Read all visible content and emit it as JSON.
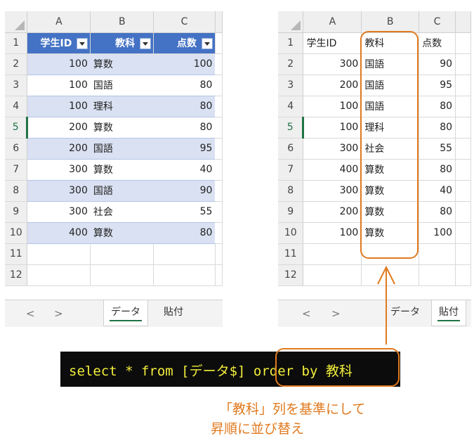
{
  "left_sheet": {
    "col_headers": [
      "A",
      "B",
      "C"
    ],
    "row_numbers": [
      "1",
      "2",
      "3",
      "4",
      "5",
      "6",
      "7",
      "8",
      "9",
      "10",
      "11",
      "12"
    ],
    "selected_row": "5",
    "table_headers": [
      "学生ID",
      "教科",
      "点数"
    ],
    "rows": [
      [
        "100",
        "算数",
        "100"
      ],
      [
        "100",
        "国語",
        "80"
      ],
      [
        "100",
        "理科",
        "80"
      ],
      [
        "200",
        "算数",
        "80"
      ],
      [
        "200",
        "国語",
        "95"
      ],
      [
        "300",
        "算数",
        "40"
      ],
      [
        "300",
        "国語",
        "90"
      ],
      [
        "300",
        "社会",
        "55"
      ],
      [
        "400",
        "算数",
        "80"
      ]
    ],
    "tabs": [
      "データ",
      "貼付"
    ],
    "active_tab": "データ"
  },
  "right_sheet": {
    "col_headers": [
      "A",
      "B",
      "C"
    ],
    "row_numbers": [
      "1",
      "2",
      "3",
      "4",
      "5",
      "6",
      "7",
      "8",
      "9",
      "10",
      "11",
      "12"
    ],
    "selected_row": "5",
    "table_headers": [
      "学生ID",
      "教科",
      "点数"
    ],
    "rows": [
      [
        "300",
        "国語",
        "90"
      ],
      [
        "200",
        "国語",
        "95"
      ],
      [
        "100",
        "国語",
        "80"
      ],
      [
        "100",
        "理科",
        "80"
      ],
      [
        "300",
        "社会",
        "55"
      ],
      [
        "400",
        "算数",
        "80"
      ],
      [
        "300",
        "算数",
        "40"
      ],
      [
        "200",
        "算数",
        "80"
      ],
      [
        "100",
        "算数",
        "100"
      ]
    ],
    "tabs": [
      "データ",
      "貼付"
    ],
    "active_tab": "貼付"
  },
  "sql": "select * from [データ$] order by 教科",
  "note_line1": "「教科」列を基準にして",
  "note_line2": "昇順に並び替え",
  "nav_prev": "<",
  "nav_next": ">",
  "accent_color": "#e07a1f",
  "table_header_color": "#4472c4",
  "band_color": "#d9e1f2"
}
